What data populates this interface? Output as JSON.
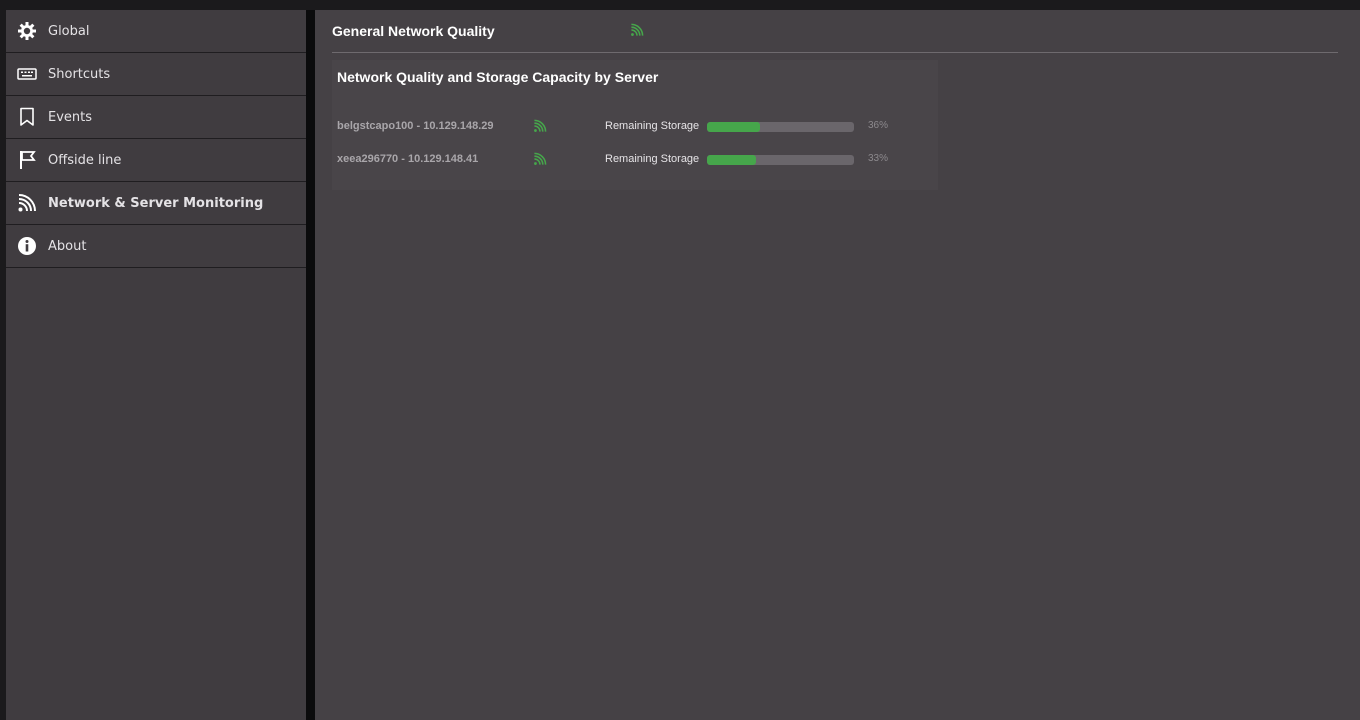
{
  "colors": {
    "accent_green": "#46a64b",
    "sidebar_bg": "#403c40",
    "main_bg": "#454145"
  },
  "sidebar": {
    "items": [
      {
        "label": "Global",
        "icon": "gear-icon",
        "active": false
      },
      {
        "label": "Shortcuts",
        "icon": "keyboard-icon",
        "active": false
      },
      {
        "label": "Events",
        "icon": "bookmark-icon",
        "active": false
      },
      {
        "label": "Offside line",
        "icon": "flag-icon",
        "active": false
      },
      {
        "label": "Network & Server Monitoring",
        "icon": "signal-icon",
        "active": true
      },
      {
        "label": "About",
        "icon": "info-icon",
        "active": false
      }
    ]
  },
  "header": {
    "title": "General Network Quality",
    "signal_icon": "signal-icon"
  },
  "panel": {
    "title": "Network Quality and Storage Capacity by Server",
    "servers": [
      {
        "name": "belgstcapo100 - 10.129.148.29",
        "signal_icon": "signal-icon",
        "storage_label": "Remaining Storage",
        "storage_percent": 36,
        "storage_text": "36%"
      },
      {
        "name": "xeea296770 - 10.129.148.41",
        "signal_icon": "signal-icon",
        "storage_label": "Remaining Storage",
        "storage_percent": 33,
        "storage_text": "33%"
      }
    ]
  }
}
